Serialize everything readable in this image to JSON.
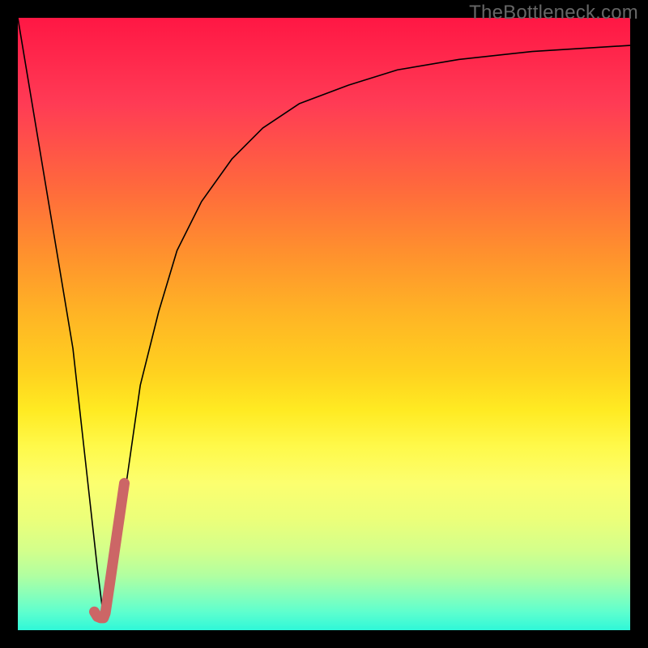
{
  "watermark": "TheBottleneck.com",
  "chart_data": {
    "type": "line",
    "title": "",
    "xlabel": "",
    "ylabel": "",
    "xlim": [
      0,
      100
    ],
    "ylim": [
      0,
      100
    ],
    "grid": false,
    "series": [
      {
        "name": "bottleneck-curve",
        "color": "#000000",
        "x": [
          0,
          3,
          6,
          9,
          11,
          13,
          14,
          16,
          18,
          20,
          23,
          26,
          30,
          35,
          40,
          46,
          54,
          62,
          72,
          84,
          100
        ],
        "y": [
          100,
          82,
          64,
          46,
          28,
          10,
          2,
          12,
          26,
          40,
          52,
          62,
          70,
          77,
          82,
          86,
          89,
          91.5,
          93.2,
          94.5,
          95.5
        ]
      },
      {
        "name": "selection-marker",
        "color": "#cc6666",
        "x": [
          12.5,
          13.0,
          13.5,
          14.0,
          14.3,
          15.0,
          15.8,
          16.6,
          17.4
        ],
        "y": [
          3.0,
          2.2,
          2.0,
          2.0,
          2.8,
          7.5,
          13.0,
          18.5,
          24.0
        ]
      }
    ],
    "gradient_stops": [
      {
        "pos": 0,
        "color": "#ff1744"
      },
      {
        "pos": 14,
        "color": "#ff3b55"
      },
      {
        "pos": 28,
        "color": "#ff6a3c"
      },
      {
        "pos": 38,
        "color": "#ff8f2e"
      },
      {
        "pos": 48,
        "color": "#ffb325"
      },
      {
        "pos": 58,
        "color": "#ffd21f"
      },
      {
        "pos": 64,
        "color": "#ffea22"
      },
      {
        "pos": 70,
        "color": "#fff94a"
      },
      {
        "pos": 76,
        "color": "#fcff6f"
      },
      {
        "pos": 82,
        "color": "#ebff7a"
      },
      {
        "pos": 87,
        "color": "#d3ff8b"
      },
      {
        "pos": 91,
        "color": "#b2ffa0"
      },
      {
        "pos": 94,
        "color": "#8affb8"
      },
      {
        "pos": 97,
        "color": "#5fffce"
      },
      {
        "pos": 100,
        "color": "#2ff7d8"
      }
    ]
  }
}
